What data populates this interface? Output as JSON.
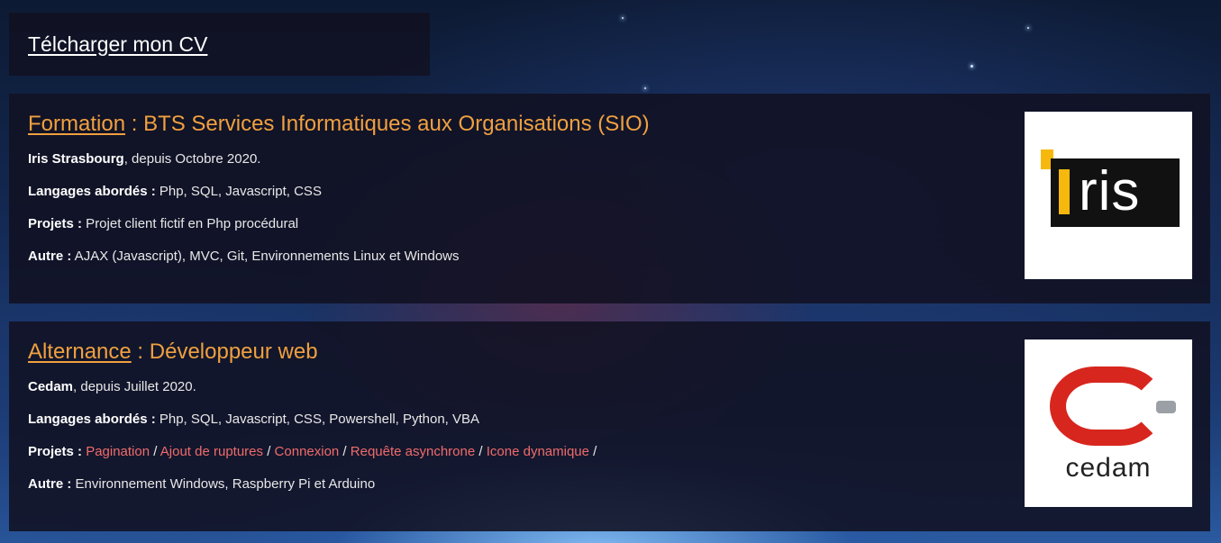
{
  "cv": {
    "label": "Télcharger mon CV"
  },
  "cards": [
    {
      "kind": "Formation",
      "separator": " : ",
      "title": "BTS Services Informatiques aux Organisations (SIO)",
      "org": "Iris Strasbourg",
      "since": ", depuis Octobre 2020.",
      "langs_label": "Langages abordés :",
      "langs": " Php, SQL, Javascript, CSS",
      "projects_label": "Projets :",
      "projects_text": " Projet client fictif en Php procédural",
      "other_label": "Autre :",
      "other": " AJAX (Javascript), MVC, Git, Environnements Linux et Windows",
      "logo": {
        "name": "iris-logo",
        "text": "IRIS"
      }
    },
    {
      "kind": "Alternance",
      "separator": " : ",
      "title": "Développeur web",
      "org": "Cedam",
      "since": ", depuis Juillet 2020.",
      "langs_label": "Langages abordés :",
      "langs": " Php, SQL, Javascript, CSS, Powershell, Python, VBA",
      "projects_label": "Projets :",
      "project_links": [
        "Pagination",
        "Ajout de ruptures",
        "Connexion",
        "Requête asynchrone",
        "Icone dynamique"
      ],
      "project_sep": " / ",
      "other_label": "Autre :",
      "other": " Environnement Windows, Raspberry Pi et Arduino",
      "logo": {
        "name": "cedam-logo",
        "text": "cedam"
      }
    }
  ],
  "colors": {
    "accent_orange": "#f0a040",
    "link_red": "#f06b6b",
    "panel_bg": "#111122",
    "iris_yellow": "#f6b80d",
    "cedam_red": "#d7261e"
  }
}
